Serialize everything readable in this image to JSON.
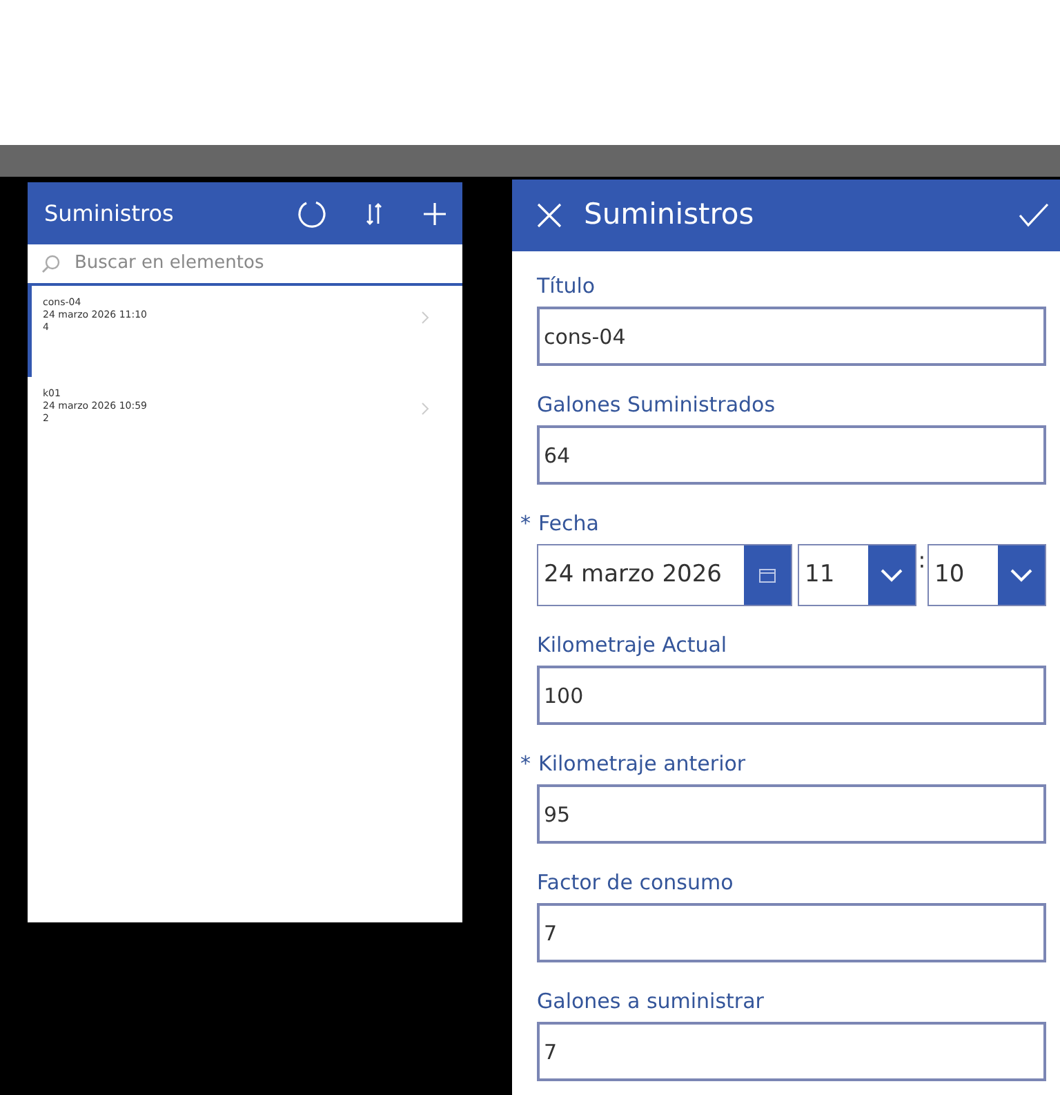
{
  "list_panel": {
    "title": "Suministros",
    "search": {
      "placeholder": "Buscar en elementos"
    },
    "items": [
      {
        "lines": [
          "cons-04",
          "24 marzo 2026 11:10",
          "4"
        ],
        "selected": true
      },
      {
        "lines": [
          "k01",
          "24 marzo 2026 10:59",
          "2"
        ],
        "selected": false
      }
    ]
  },
  "form_panel": {
    "title": "Suministros",
    "fields": [
      {
        "kind": "text",
        "label": "Título",
        "value": "cons-04"
      },
      {
        "kind": "text",
        "label": "Galones Suministrados",
        "value": "64"
      },
      {
        "kind": "datetime",
        "label": "Fecha",
        "required_mark": "*",
        "date": "24 marzo 2026",
        "hour": "11",
        "separator": ":",
        "minute": "10"
      },
      {
        "kind": "text",
        "label": "Kilometraje Actual",
        "value": "100"
      },
      {
        "kind": "text",
        "label": "Kilometraje anterior",
        "required_mark": "*",
        "value": "95"
      },
      {
        "kind": "text",
        "label": "Factor de consumo",
        "value": "7"
      },
      {
        "kind": "text",
        "label": "Galones a suministrar",
        "value": "7"
      }
    ]
  }
}
